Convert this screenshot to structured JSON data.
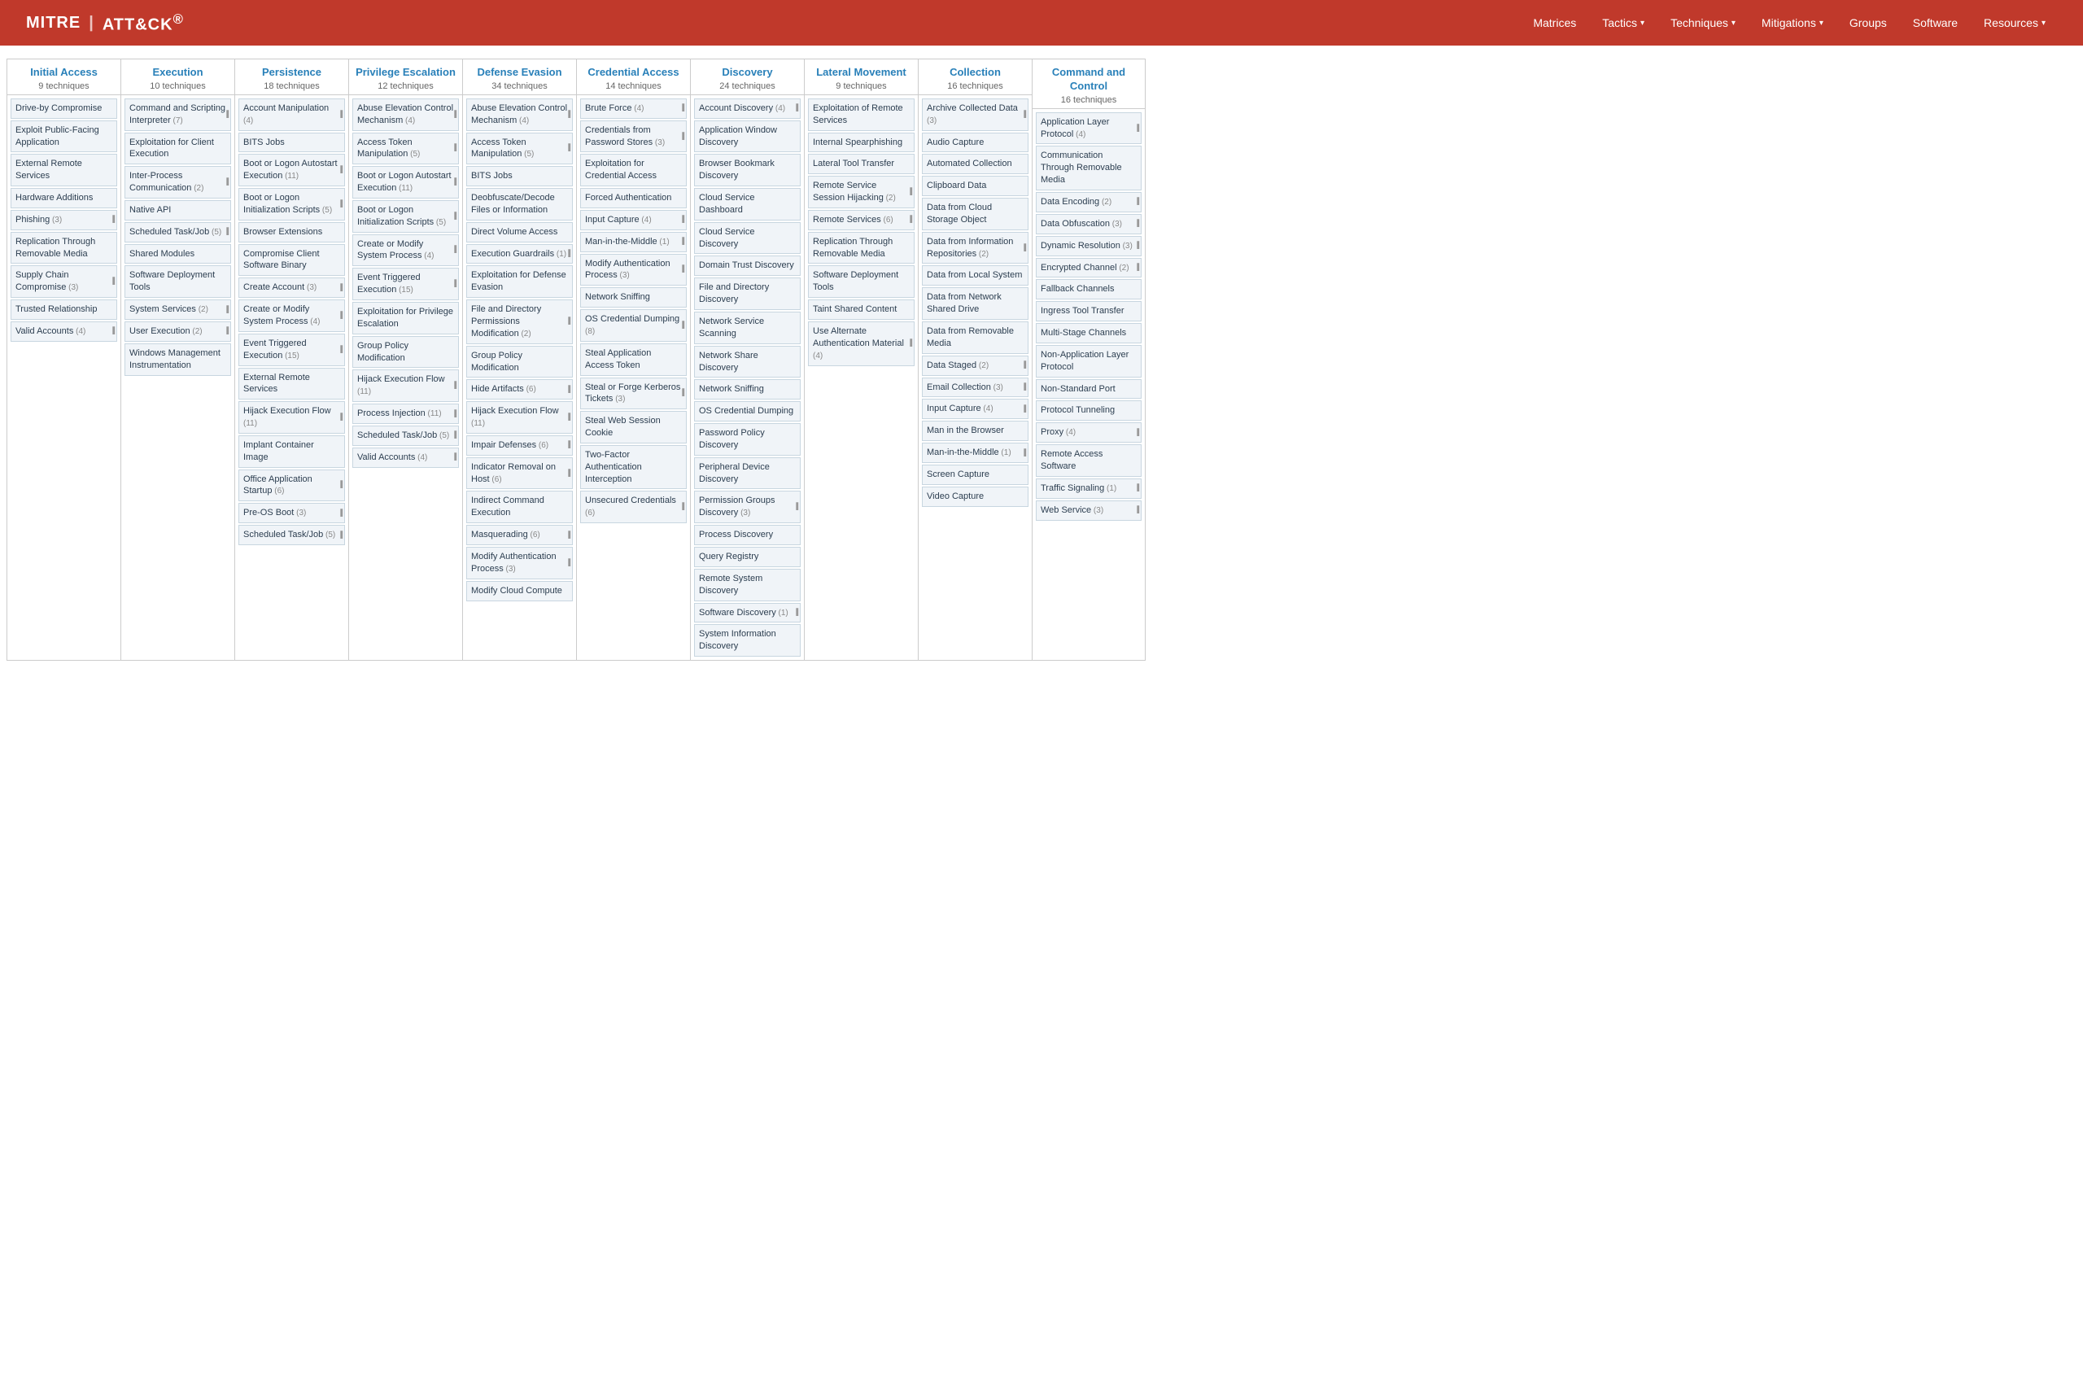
{
  "navbar": {
    "logo_mitre": "MITRE",
    "logo_divider": "|",
    "logo_attack": "ATT&CK®",
    "nav_items": [
      {
        "label": "Matrices",
        "dropdown": false
      },
      {
        "label": "Tactics",
        "dropdown": true
      },
      {
        "label": "Techniques",
        "dropdown": true
      },
      {
        "label": "Mitigations",
        "dropdown": true
      },
      {
        "label": "Groups",
        "dropdown": false
      },
      {
        "label": "Software",
        "dropdown": false
      },
      {
        "label": "Resources",
        "dropdown": true
      }
    ]
  },
  "tactics": [
    {
      "name": "Initial Access",
      "count": "9 techniques",
      "techniques": [
        {
          "name": "Drive-by Compromise",
          "count": null,
          "sub": false
        },
        {
          "name": "Exploit Public-Facing Application",
          "count": null,
          "sub": false
        },
        {
          "name": "External Remote Services",
          "count": null,
          "sub": false
        },
        {
          "name": "Hardware Additions",
          "count": null,
          "sub": false
        },
        {
          "name": "Phishing",
          "count": "(3)",
          "sub": true
        },
        {
          "name": "Replication Through Removable Media",
          "count": null,
          "sub": false
        },
        {
          "name": "Supply Chain Compromise",
          "count": "(3)",
          "sub": true
        },
        {
          "name": "Trusted Relationship",
          "count": null,
          "sub": false
        },
        {
          "name": "Valid Accounts",
          "count": "(4)",
          "sub": true
        }
      ]
    },
    {
      "name": "Execution",
      "count": "10 techniques",
      "techniques": [
        {
          "name": "Command and Scripting Interpreter",
          "count": "(7)",
          "sub": true
        },
        {
          "name": "Exploitation for Client Execution",
          "count": null,
          "sub": false
        },
        {
          "name": "Inter-Process Communication",
          "count": "(2)",
          "sub": true
        },
        {
          "name": "Native API",
          "count": null,
          "sub": false
        },
        {
          "name": "Scheduled Task/Job",
          "count": "(5)",
          "sub": true
        },
        {
          "name": "Shared Modules",
          "count": null,
          "sub": false
        },
        {
          "name": "Software Deployment Tools",
          "count": null,
          "sub": false
        },
        {
          "name": "System Services",
          "count": "(2)",
          "sub": true
        },
        {
          "name": "User Execution",
          "count": "(2)",
          "sub": true
        },
        {
          "name": "Windows Management Instrumentation",
          "count": null,
          "sub": false
        }
      ]
    },
    {
      "name": "Persistence",
      "count": "18 techniques",
      "techniques": [
        {
          "name": "Account Manipulation",
          "count": "(4)",
          "sub": true
        },
        {
          "name": "BITS Jobs",
          "count": null,
          "sub": false
        },
        {
          "name": "Boot or Logon Autostart Execution",
          "count": "(11)",
          "sub": true
        },
        {
          "name": "Boot or Logon Initialization Scripts",
          "count": "(5)",
          "sub": true
        },
        {
          "name": "Browser Extensions",
          "count": null,
          "sub": false
        },
        {
          "name": "Compromise Client Software Binary",
          "count": null,
          "sub": false
        },
        {
          "name": "Create Account",
          "count": "(3)",
          "sub": true
        },
        {
          "name": "Create or Modify System Process",
          "count": "(4)",
          "sub": true
        },
        {
          "name": "Event Triggered Execution",
          "count": "(15)",
          "sub": true
        },
        {
          "name": "External Remote Services",
          "count": null,
          "sub": false
        },
        {
          "name": "Hijack Execution Flow",
          "count": "(11)",
          "sub": true
        },
        {
          "name": "Implant Container Image",
          "count": null,
          "sub": false
        },
        {
          "name": "Office Application Startup",
          "count": "(6)",
          "sub": true
        },
        {
          "name": "Pre-OS Boot",
          "count": "(3)",
          "sub": true
        },
        {
          "name": "Scheduled Task/Job",
          "count": "(5)",
          "sub": true
        }
      ]
    },
    {
      "name": "Privilege Escalation",
      "count": "12 techniques",
      "techniques": [
        {
          "name": "Abuse Elevation Control Mechanism",
          "count": "(4)",
          "sub": true
        },
        {
          "name": "Access Token Manipulation",
          "count": "(5)",
          "sub": true
        },
        {
          "name": "Boot or Logon Autostart Execution",
          "count": "(11)",
          "sub": true
        },
        {
          "name": "Boot or Logon Initialization Scripts",
          "count": "(5)",
          "sub": true
        },
        {
          "name": "Create or Modify System Process",
          "count": "(4)",
          "sub": true
        },
        {
          "name": "Event Triggered Execution",
          "count": "(15)",
          "sub": true
        },
        {
          "name": "Exploitation for Privilege Escalation",
          "count": null,
          "sub": false
        },
        {
          "name": "Group Policy Modification",
          "count": null,
          "sub": false
        },
        {
          "name": "Hijack Execution Flow",
          "count": "(11)",
          "sub": true
        },
        {
          "name": "Process Injection",
          "count": "(11)",
          "sub": true
        },
        {
          "name": "Scheduled Task/Job",
          "count": "(5)",
          "sub": true
        },
        {
          "name": "Valid Accounts",
          "count": "(4)",
          "sub": true
        }
      ]
    },
    {
      "name": "Defense Evasion",
      "count": "34 techniques",
      "techniques": [
        {
          "name": "Abuse Elevation Control Mechanism",
          "count": "(4)",
          "sub": true
        },
        {
          "name": "Access Token Manipulation",
          "count": "(5)",
          "sub": true
        },
        {
          "name": "BITS Jobs",
          "count": null,
          "sub": false
        },
        {
          "name": "Deobfuscate/Decode Files or Information",
          "count": null,
          "sub": false
        },
        {
          "name": "Direct Volume Access",
          "count": null,
          "sub": false
        },
        {
          "name": "Execution Guardrails",
          "count": "(1)",
          "sub": true
        },
        {
          "name": "Exploitation for Defense Evasion",
          "count": null,
          "sub": false
        },
        {
          "name": "File and Directory Permissions Modification",
          "count": "(2)",
          "sub": true
        },
        {
          "name": "Group Policy Modification",
          "count": null,
          "sub": false
        },
        {
          "name": "Hide Artifacts",
          "count": "(6)",
          "sub": true
        },
        {
          "name": "Hijack Execution Flow",
          "count": "(11)",
          "sub": true
        },
        {
          "name": "Impair Defenses",
          "count": "(6)",
          "sub": true
        },
        {
          "name": "Indicator Removal on Host",
          "count": "(6)",
          "sub": true
        },
        {
          "name": "Indirect Command Execution",
          "count": null,
          "sub": false
        },
        {
          "name": "Masquerading",
          "count": "(6)",
          "sub": true
        },
        {
          "name": "Modify Authentication Process",
          "count": "(3)",
          "sub": true
        },
        {
          "name": "Modify Cloud Compute",
          "count": null,
          "sub": false
        }
      ]
    },
    {
      "name": "Credential Access",
      "count": "14 techniques",
      "techniques": [
        {
          "name": "Brute Force",
          "count": "(4)",
          "sub": true
        },
        {
          "name": "Credentials from Password Stores",
          "count": "(3)",
          "sub": true
        },
        {
          "name": "Exploitation for Credential Access",
          "count": null,
          "sub": false
        },
        {
          "name": "Forced Authentication",
          "count": null,
          "sub": false
        },
        {
          "name": "Input Capture",
          "count": "(4)",
          "sub": true
        },
        {
          "name": "Man-in-the-Middle",
          "count": "(1)",
          "sub": true
        },
        {
          "name": "Modify Authentication Process",
          "count": "(3)",
          "sub": true
        },
        {
          "name": "Network Sniffing",
          "count": null,
          "sub": false
        },
        {
          "name": "OS Credential Dumping",
          "count": "(8)",
          "sub": true
        },
        {
          "name": "Steal Application Access Token",
          "count": null,
          "sub": false
        },
        {
          "name": "Steal or Forge Kerberos Tickets",
          "count": "(3)",
          "sub": true
        },
        {
          "name": "Steal Web Session Cookie",
          "count": null,
          "sub": false
        },
        {
          "name": "Two-Factor Authentication Interception",
          "count": null,
          "sub": false
        },
        {
          "name": "Unsecured Credentials",
          "count": "(6)",
          "sub": true
        }
      ]
    },
    {
      "name": "Discovery",
      "count": "24 techniques",
      "techniques": [
        {
          "name": "Account Discovery",
          "count": "(4)",
          "sub": true
        },
        {
          "name": "Application Window Discovery",
          "count": null,
          "sub": false
        },
        {
          "name": "Browser Bookmark Discovery",
          "count": null,
          "sub": false
        },
        {
          "name": "Cloud Service Dashboard",
          "count": null,
          "sub": false
        },
        {
          "name": "Cloud Service Discovery",
          "count": null,
          "sub": false
        },
        {
          "name": "Domain Trust Discovery",
          "count": null,
          "sub": false
        },
        {
          "name": "File and Directory Discovery",
          "count": null,
          "sub": false
        },
        {
          "name": "Network Service Scanning",
          "count": null,
          "sub": false
        },
        {
          "name": "Network Share Discovery",
          "count": null,
          "sub": false
        },
        {
          "name": "Network Sniffing",
          "count": null,
          "sub": false
        },
        {
          "name": "OS Credential Dumping",
          "count": null,
          "sub": false
        },
        {
          "name": "Password Policy Discovery",
          "count": null,
          "sub": false
        },
        {
          "name": "Peripheral Device Discovery",
          "count": null,
          "sub": false
        },
        {
          "name": "Permission Groups Discovery",
          "count": "(3)",
          "sub": true
        },
        {
          "name": "Process Discovery",
          "count": null,
          "sub": false
        },
        {
          "name": "Query Registry",
          "count": null,
          "sub": false
        },
        {
          "name": "Remote System Discovery",
          "count": null,
          "sub": false
        },
        {
          "name": "Software Discovery",
          "count": "(1)",
          "sub": true
        },
        {
          "name": "System Information Discovery",
          "count": null,
          "sub": false
        }
      ]
    },
    {
      "name": "Lateral Movement",
      "count": "9 techniques",
      "techniques": [
        {
          "name": "Exploitation of Remote Services",
          "count": null,
          "sub": false
        },
        {
          "name": "Internal Spearphishing",
          "count": null,
          "sub": false
        },
        {
          "name": "Lateral Tool Transfer",
          "count": null,
          "sub": false
        },
        {
          "name": "Remote Service Session Hijacking",
          "count": "(2)",
          "sub": true
        },
        {
          "name": "Remote Services",
          "count": "(6)",
          "sub": true
        },
        {
          "name": "Replication Through Removable Media",
          "count": null,
          "sub": false
        },
        {
          "name": "Software Deployment Tools",
          "count": null,
          "sub": false
        },
        {
          "name": "Taint Shared Content",
          "count": null,
          "sub": false
        },
        {
          "name": "Use Alternate Authentication Material",
          "count": "(4)",
          "sub": true
        }
      ]
    },
    {
      "name": "Collection",
      "count": "16 techniques",
      "techniques": [
        {
          "name": "Archive Collected Data",
          "count": "(3)",
          "sub": true
        },
        {
          "name": "Audio Capture",
          "count": null,
          "sub": false
        },
        {
          "name": "Automated Collection",
          "count": null,
          "sub": false
        },
        {
          "name": "Clipboard Data",
          "count": null,
          "sub": false
        },
        {
          "name": "Data from Cloud Storage Object",
          "count": null,
          "sub": false
        },
        {
          "name": "Data from Information Repositories",
          "count": "(2)",
          "sub": true
        },
        {
          "name": "Data from Local System",
          "count": null,
          "sub": false
        },
        {
          "name": "Data from Network Shared Drive",
          "count": null,
          "sub": false
        },
        {
          "name": "Data from Removable Media",
          "count": null,
          "sub": false
        },
        {
          "name": "Data Staged",
          "count": "(2)",
          "sub": true
        },
        {
          "name": "Email Collection",
          "count": "(3)",
          "sub": true
        },
        {
          "name": "Input Capture",
          "count": "(4)",
          "sub": true
        },
        {
          "name": "Man in the Browser",
          "count": null,
          "sub": false
        },
        {
          "name": "Man-in-the-Middle",
          "count": "(1)",
          "sub": true
        },
        {
          "name": "Screen Capture",
          "count": null,
          "sub": false
        },
        {
          "name": "Video Capture",
          "count": null,
          "sub": false
        }
      ]
    },
    {
      "name": "Command and Control",
      "count": "16 techniques",
      "techniques": [
        {
          "name": "Application Layer Protocol",
          "count": "(4)",
          "sub": true
        },
        {
          "name": "Communication Through Removable Media",
          "count": null,
          "sub": false
        },
        {
          "name": "Data Encoding",
          "count": "(2)",
          "sub": true
        },
        {
          "name": "Data Obfuscation",
          "count": "(3)",
          "sub": true
        },
        {
          "name": "Dynamic Resolution",
          "count": "(3)",
          "sub": true
        },
        {
          "name": "Encrypted Channel",
          "count": "(2)",
          "sub": true
        },
        {
          "name": "Fallback Channels",
          "count": null,
          "sub": false
        },
        {
          "name": "Ingress Tool Transfer",
          "count": null,
          "sub": false
        },
        {
          "name": "Multi-Stage Channels",
          "count": null,
          "sub": false
        },
        {
          "name": "Non-Application Layer Protocol",
          "count": null,
          "sub": false
        },
        {
          "name": "Non-Standard Port",
          "count": null,
          "sub": false
        },
        {
          "name": "Protocol Tunneling",
          "count": null,
          "sub": false
        },
        {
          "name": "Proxy",
          "count": "(4)",
          "sub": true
        },
        {
          "name": "Remote Access Software",
          "count": null,
          "sub": false
        },
        {
          "name": "Traffic Signaling",
          "count": "(1)",
          "sub": true
        },
        {
          "name": "Web Service",
          "count": "(3)",
          "sub": true
        }
      ]
    }
  ]
}
